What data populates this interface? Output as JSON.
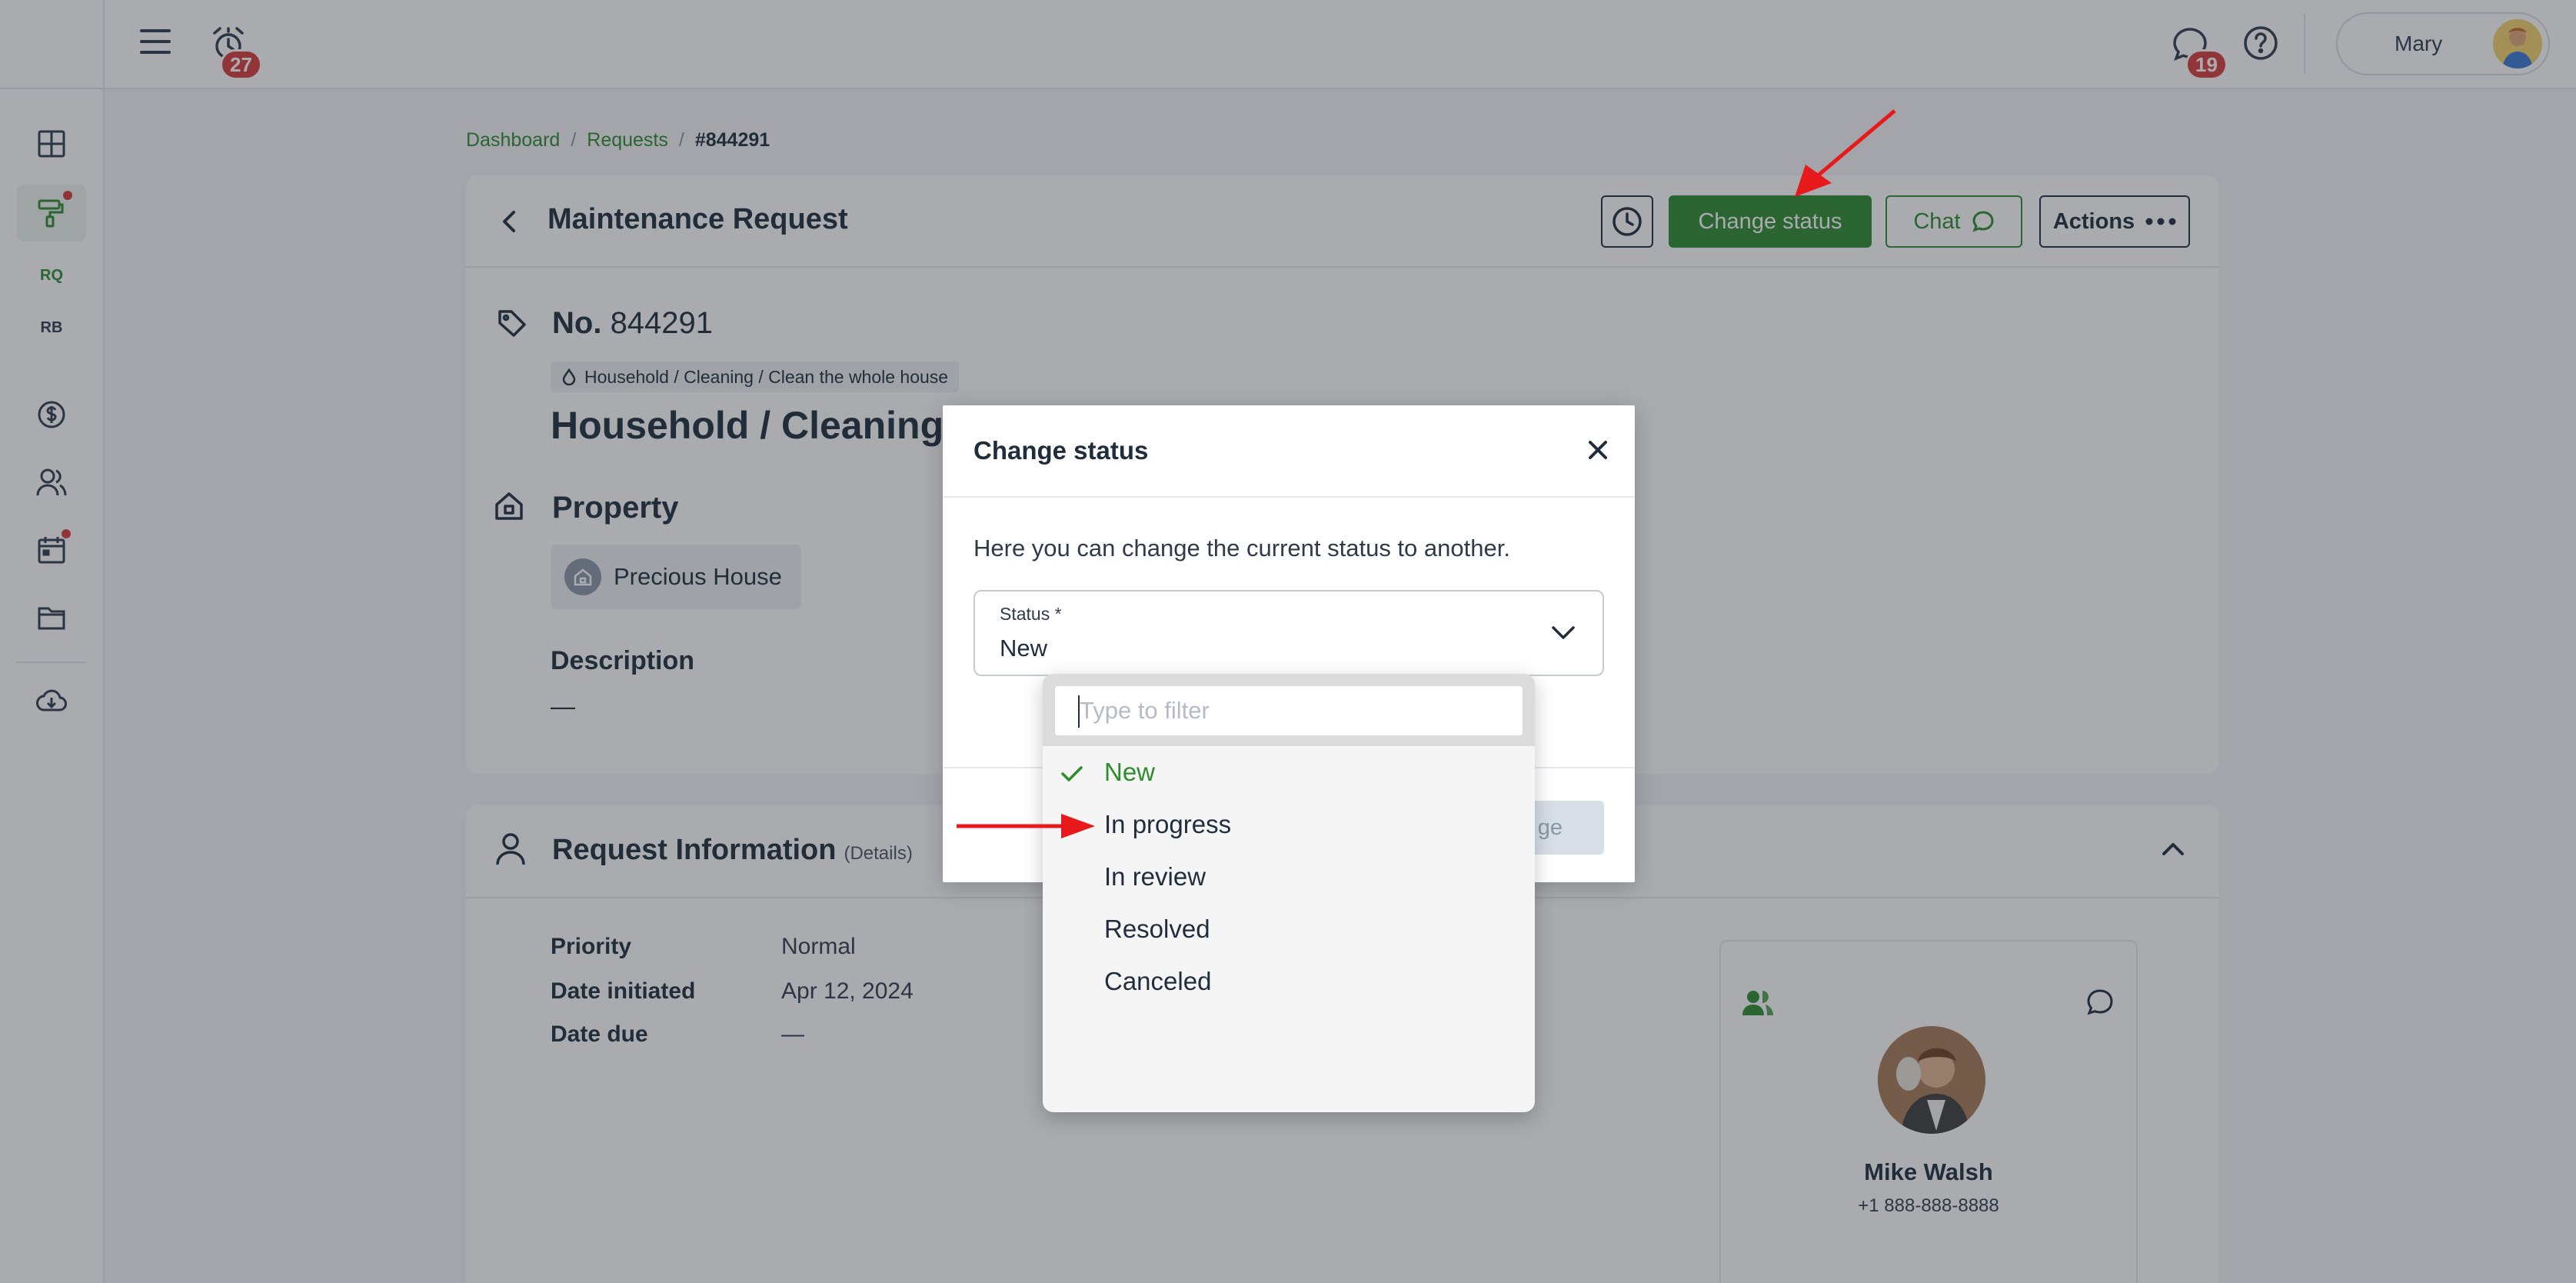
{
  "topbar": {
    "alerts_count": "27",
    "messages_count": "19",
    "user_name": "Mary"
  },
  "sidebar": {
    "items": [
      {
        "label": "RQ"
      },
      {
        "label": "RB"
      }
    ]
  },
  "breadcrumb": {
    "items": [
      "Dashboard",
      "Requests",
      "#844291"
    ],
    "separator": "/"
  },
  "request": {
    "header_title": "Maintenance Request",
    "buttons": {
      "change_status": "Change status",
      "chat": "Chat",
      "actions": "Actions"
    },
    "number_label": "No.",
    "number_value": "844291",
    "category_tag": "Household / Cleaning / Clean the whole house",
    "title": "Household / Cleaning /",
    "property_label": "Property",
    "property_name": "Precious House",
    "description_label": "Description",
    "description_value": "—"
  },
  "info": {
    "title": "Request Information",
    "subtitle": "(Details)",
    "rows": [
      {
        "key": "Priority",
        "value": "Normal"
      },
      {
        "key": "Date initiated",
        "value": "Apr 12, 2024"
      },
      {
        "key": "Date due",
        "value": "—"
      }
    ],
    "contact": {
      "name": "Mike Walsh",
      "phone": "+1 888-888-8888"
    }
  },
  "modal": {
    "title": "Change status",
    "text": "Here you can change the current status to another.",
    "field_label": "Status *",
    "field_value": "New",
    "confirm_button_visible_text": "ge"
  },
  "dropdown": {
    "filter_placeholder": "Type to filter",
    "options": [
      "New",
      "In progress",
      "In review",
      "Resolved",
      "Canceled"
    ],
    "selected": "New"
  },
  "colors": {
    "accent_green": "#2e8b2e",
    "alert_red": "#d93b3b",
    "annotation_arrow": "#e8191b"
  }
}
